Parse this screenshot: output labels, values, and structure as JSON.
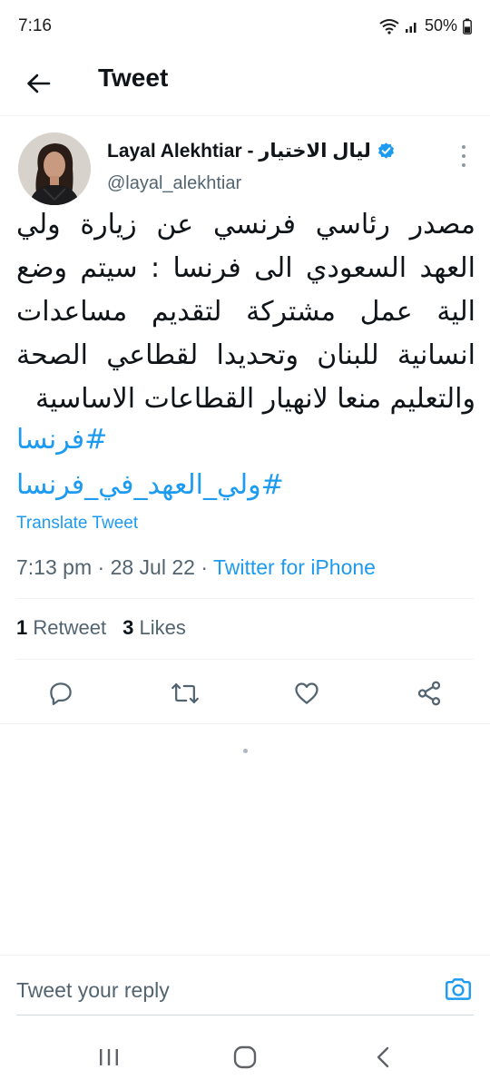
{
  "status_bar": {
    "time": "7:16",
    "battery": "50%"
  },
  "header": {
    "title": "Tweet",
    "back_icon": "arrow-left-icon"
  },
  "tweet": {
    "author": {
      "display_name": "Layal Alekhtiar - ليال الاختيار",
      "handle": "@layal_alekhtiar",
      "verified": true
    },
    "text": "مصدر رئاسي فرنسي عن زيارة ولي العهد السعودي الى فرنسا : سيتم وضع الية عمل مشتركة لتقديم مساعدات انسانية للبنان وتحديدا لقطاعي الصحة والتعليم منعا لانهيار القطاعات الاساسية",
    "hashtags": [
      "#فرنسا",
      "#ولي_العهد_في_فرنسا"
    ],
    "translate_label": "Translate Tweet",
    "time": "7:13 pm",
    "date": "28 Jul 22",
    "separator": "·",
    "source": "Twitter for iPhone",
    "stats": {
      "retweets_count": "1",
      "retweets_label": "Retweet",
      "likes_count": "3",
      "likes_label": "Likes"
    },
    "actions": [
      "reply-icon",
      "retweet-icon",
      "like-icon",
      "share-icon"
    ]
  },
  "reply": {
    "placeholder": "Tweet your reply"
  },
  "colors": {
    "accent": "#1d9bf0",
    "text": "#0f1419",
    "secondary": "#536471",
    "divider": "#eff3f4"
  }
}
